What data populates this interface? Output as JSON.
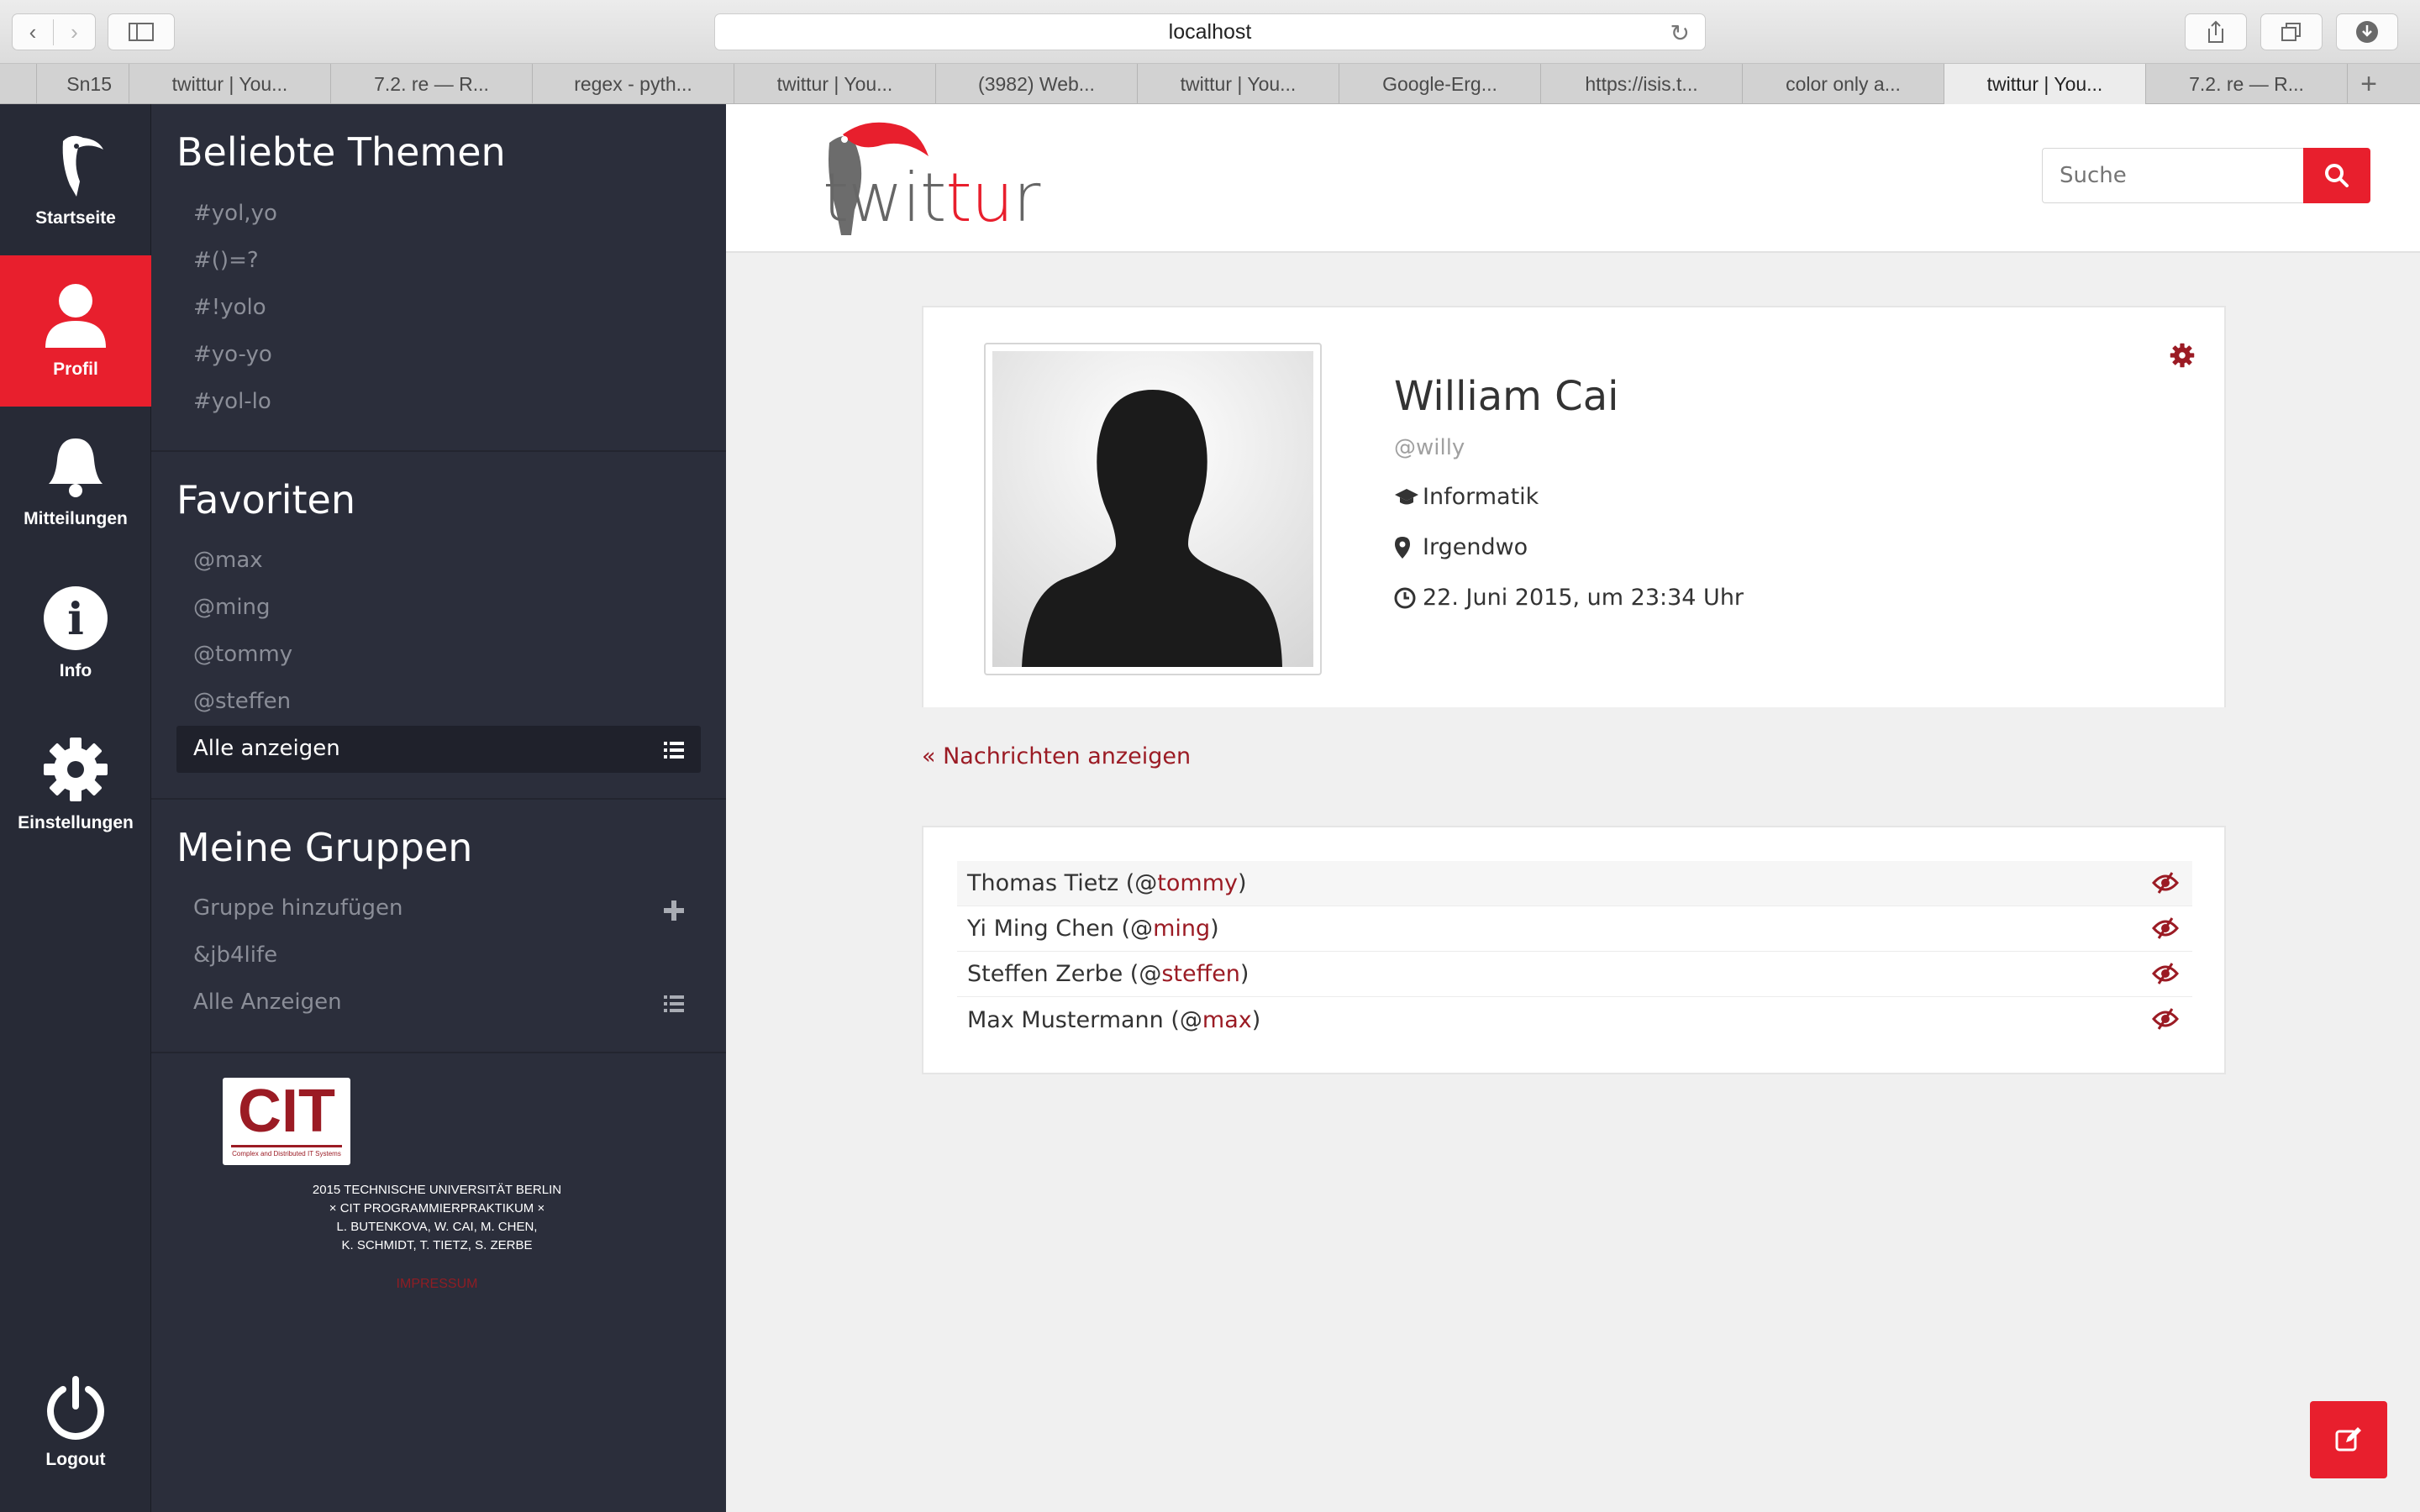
{
  "browser": {
    "url": "localhost",
    "tabs": [
      "Sn15",
      "twittur | You...",
      "7.2. re — R...",
      "regex - pyth...",
      "twittur | You...",
      "(3982) Web...",
      "twittur | You...",
      "Google-Erg...",
      "https://isis.t...",
      "color only a...",
      "twittur | You...",
      "7.2. re — R..."
    ]
  },
  "nav": {
    "home": "Startseite",
    "profile": "Profil",
    "notifications": "Mitteilungen",
    "info": "Info",
    "settings": "Einstellungen",
    "logout": "Logout"
  },
  "sidebar": {
    "topics_title": "Beliebte Themen",
    "topics": [
      "#yol,yo",
      "#()=?",
      "#!yolo",
      "#yo-yo",
      "#yol-lo"
    ],
    "favorites_title": "Favoriten",
    "favorites": [
      "@max",
      "@ming",
      "@tommy",
      "@steffen"
    ],
    "show_all": "Alle anzeigen",
    "groups_title": "Meine Gruppen",
    "add_group": "Gruppe hinzufügen",
    "groups": [
      "&jb4life"
    ],
    "groups_show_all": "Alle Anzeigen",
    "logo_text": "CIT",
    "logo_sub": "Complex and Distributed IT Systems",
    "credits": [
      "2015 Technische Universität Berlin",
      "× CIT Programmierpraktikum ×",
      "L. Butenkova, W. Cai, M. Chen,",
      "K. Schmidt, T. Tietz, S. Zerbe"
    ],
    "impressum": "Impressum"
  },
  "header": {
    "brand_a": "twit",
    "brand_b": "tu",
    "brand_c": "r",
    "search_placeholder": "Suche"
  },
  "profile": {
    "name": "William Cai",
    "handle": "@willy",
    "study": "Informatik",
    "location": "Irgendwo",
    "date": "22. Juni 2015, um 23:34 Uhr"
  },
  "back_link": "« Nachrichten anzeigen",
  "following": [
    {
      "name": "Thomas Tietz",
      "handle": "tommy"
    },
    {
      "name": "Yi Ming Chen",
      "handle": "ming"
    },
    {
      "name": "Steffen Zerbe",
      "handle": "steffen"
    },
    {
      "name": "Max Mustermann",
      "handle": "max"
    }
  ],
  "colors": {
    "accent": "#e81f2d",
    "dark_red": "#9b1b24",
    "sidebar": "#2b2e3b",
    "nav": "#272a36"
  }
}
